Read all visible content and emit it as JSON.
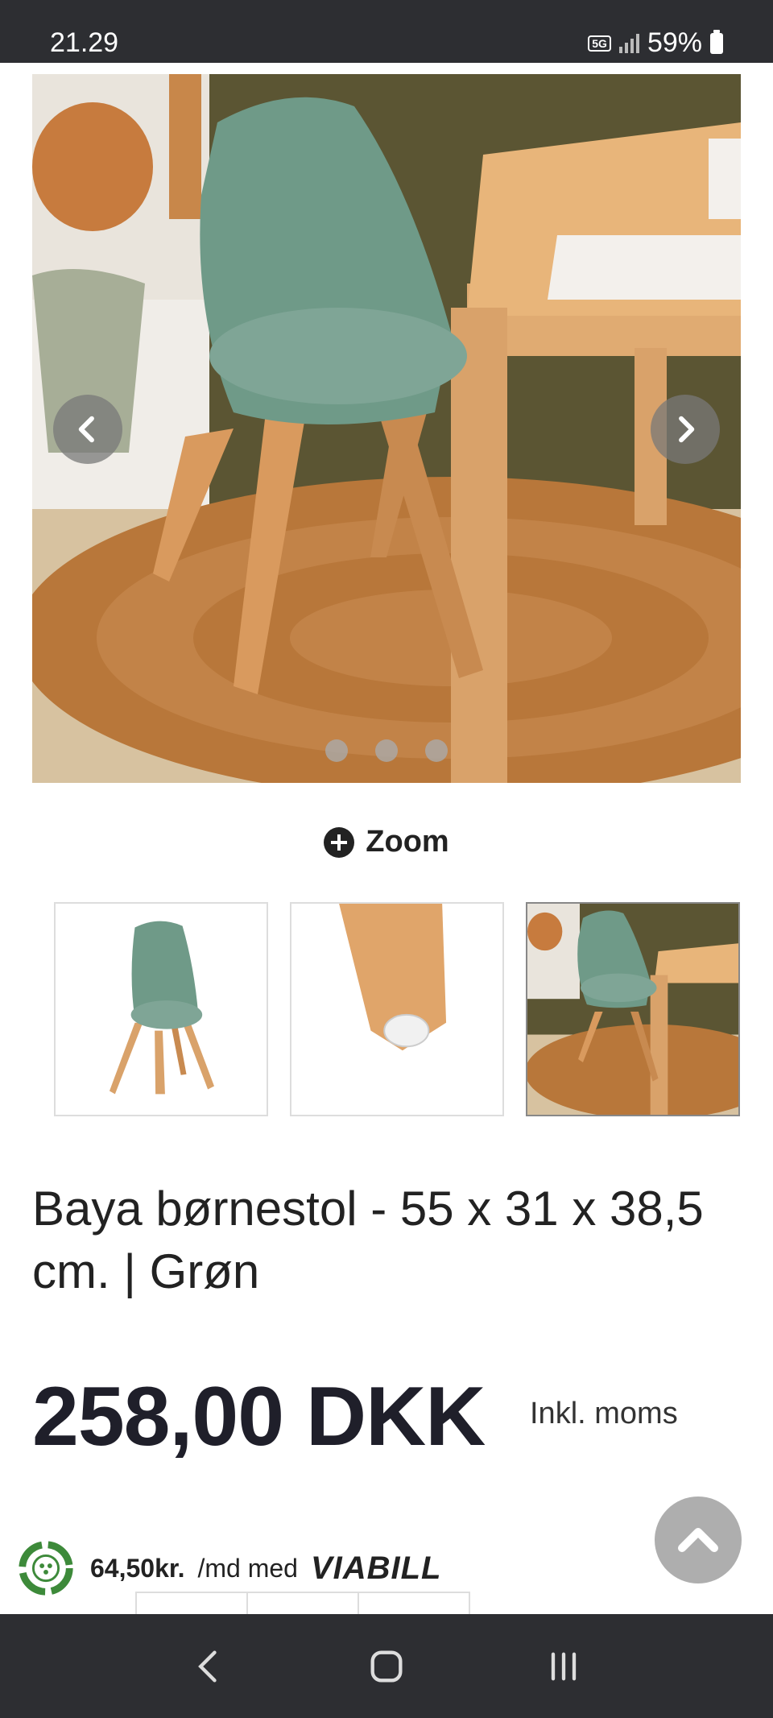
{
  "status_bar": {
    "time": "21.29",
    "network": "5G",
    "battery": "59%"
  },
  "gallery": {
    "slide_count": 3,
    "active_thumb": 3,
    "zoom_label": "Zoom"
  },
  "product": {
    "title": "Baya børnestol - 55 x 31 x 38,5 cm. | Grøn",
    "price": "258,00 DKK",
    "vat_note": "Inkl. moms"
  },
  "viabill": {
    "amount": "64,50kr.",
    "suffix": "/md med",
    "brand": "VIABILL"
  },
  "colors": {
    "chair_green": "#7fa596",
    "wood": "#d9a26a",
    "rug": "#b8773a",
    "wall": "#5a5432",
    "dark_bar": "#2d2e32"
  },
  "icons": {
    "prev": "chevron-left-icon",
    "next": "chevron-right-icon",
    "zoom": "plus-circle-icon",
    "scroll_top": "chevron-up-icon",
    "nav_back": "back-icon",
    "nav_home": "home-icon",
    "nav_recents": "recents-icon"
  }
}
